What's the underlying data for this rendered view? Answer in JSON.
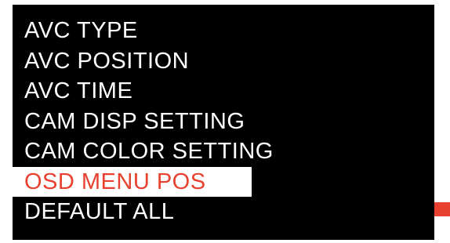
{
  "osd_menu": {
    "items": [
      {
        "label": "AVC TYPE",
        "selected": false
      },
      {
        "label": "AVC POSITION",
        "selected": false
      },
      {
        "label": "AVC TIME",
        "selected": false
      },
      {
        "label": "CAM DISP SETTING",
        "selected": false
      },
      {
        "label": "CAM COLOR SETTING",
        "selected": false
      },
      {
        "label": "OSD MENU POS",
        "selected": true
      },
      {
        "label": "DEFAULT ALL",
        "selected": false
      }
    ],
    "selected_index": 5
  },
  "colors": {
    "screen_background": "#000000",
    "text": "#ffffff",
    "highlight_background": "#ffffff",
    "highlight_text": "#e8412f",
    "scroll_thumb": "#e8412f"
  }
}
